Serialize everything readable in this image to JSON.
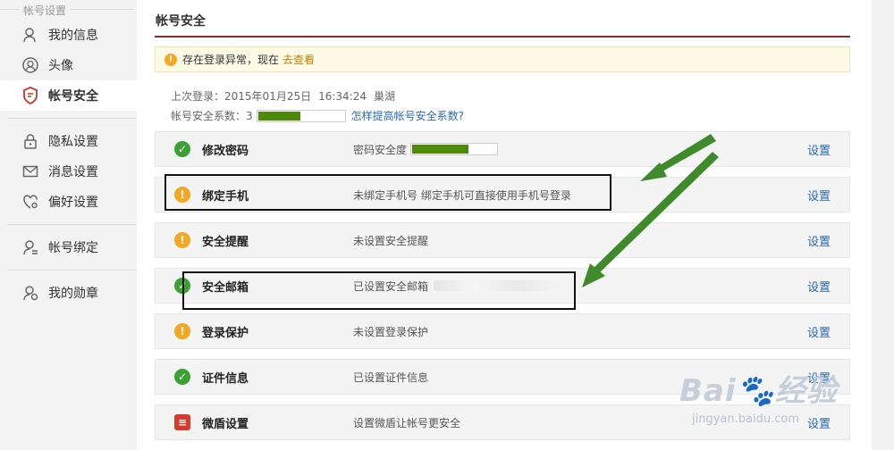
{
  "sidebar": {
    "section_title": "帐号设置",
    "items": [
      {
        "label": "我的信息",
        "icon": "user-icon"
      },
      {
        "label": "头像",
        "icon": "avatar-icon"
      },
      {
        "label": "帐号安全",
        "icon": "shield-icon",
        "active": true
      },
      {
        "label": "隐私设置",
        "icon": "lock-icon"
      },
      {
        "label": "消息设置",
        "icon": "mail-icon"
      },
      {
        "label": "偏好设置",
        "icon": "heart-gear-icon"
      },
      {
        "label": "帐号绑定",
        "icon": "user-link-icon"
      },
      {
        "label": "我的勋章",
        "icon": "medal-user-icon"
      }
    ]
  },
  "main": {
    "title": "帐号安全",
    "alert": {
      "text": "存在登录异常，现在",
      "link": "去查看"
    },
    "last_login": {
      "label": "上次登录：",
      "date": "2015年01月25日",
      "time": "16:34:24",
      "place": "巢湖"
    },
    "security_level": {
      "label": "帐号安全系数：",
      "value": "3",
      "fill_fraction": 0.48,
      "help_link": "怎样提高帐号安全系数?"
    },
    "rows": [
      {
        "status": "ok",
        "name": "修改密码",
        "desc": "密码安全度",
        "password_strength_fraction": 0.66,
        "action": "设置"
      },
      {
        "status": "warn",
        "name": "绑定手机",
        "desc": "未绑定手机号 绑定手机可直接使用手机号登录",
        "action": "设置"
      },
      {
        "status": "warn",
        "name": "安全提醒",
        "desc": "未设置安全提醒",
        "action": "设置"
      },
      {
        "status": "ok",
        "name": "安全邮箱",
        "desc": "已设置安全邮箱",
        "action": "设置"
      },
      {
        "status": "warn",
        "name": "登录保护",
        "desc": "未设置登录保护",
        "action": "设置"
      },
      {
        "status": "ok",
        "name": "证件信息",
        "desc": "已设置证件信息",
        "action": "设置"
      },
      {
        "status": "shield",
        "name": "微盾设置",
        "desc": "设置微盾让帐号更安全",
        "action": "设置"
      }
    ]
  },
  "watermark": {
    "brand": "Bai",
    "brand2": "经验",
    "url": "jingyan.baidu.com"
  },
  "colors": {
    "title_rule": "#8d2a2a",
    "link": "#2a6bb0",
    "ok": "#3da033",
    "warn": "#f5a623",
    "bar_fill": "#4d8a0c",
    "arrow": "#3f8a2a"
  }
}
